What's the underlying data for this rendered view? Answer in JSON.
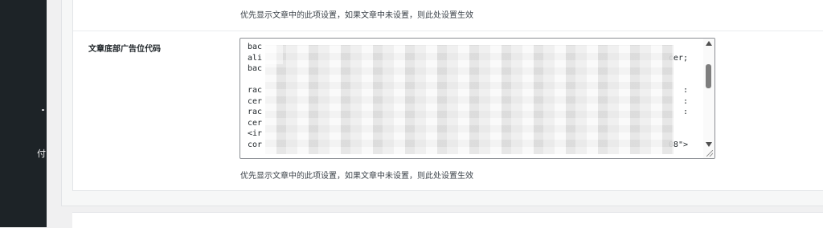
{
  "sidebar": {
    "menu_item_fragment": "付"
  },
  "setting": {
    "description_top": "优先显示文章中的此项设置，如果文章中未设置，则此处设置生效",
    "label": "文章底部广告位代码",
    "code_lines": [
      {
        "start": "bac",
        "end": ""
      },
      {
        "start": "ali",
        "end": "cer;"
      },
      {
        "start": "bac",
        "end": ""
      },
      {
        "start": "",
        "end": ""
      },
      {
        "start": "rac",
        "end": ":"
      },
      {
        "start": "cer",
        "end": ":"
      },
      {
        "start": "rac",
        "end": ":"
      },
      {
        "start": "cer",
        "end": ""
      },
      {
        "start": "<ir",
        "end": ""
      },
      {
        "start": "cor",
        "end": "08\">"
      }
    ],
    "description_bottom": "优先显示文章中的此项设置，如果文章中未设置，则此处设置生效"
  }
}
